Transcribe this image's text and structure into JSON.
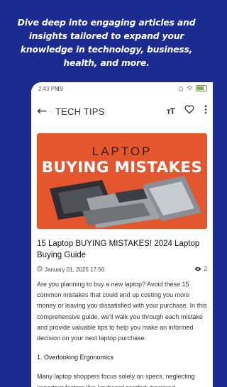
{
  "promo": {
    "line1": "Dive deep into engaging articles and",
    "line2": "insights tailored to expand your",
    "line3": "knowledge in technology, business,",
    "line4": "health, and more."
  },
  "statusbar": {
    "time": "2:43 PM",
    "indicator": "19"
  },
  "appbar": {
    "title": "TECH TIPS"
  },
  "hero": {
    "top": "LAPTOP",
    "main": "BUYING MISTAKES"
  },
  "article": {
    "title": "15 Laptop BUYING MISTAKES! 2024 Laptop Buying Guide",
    "date": "January 01, 2025 17:56",
    "views": "2",
    "intro": "Are you planning to buy a new laptop? Avoid these 15 common mistakes that could end up costing you more money or leaving you dissatisfied with your purchase. In this comprehensive guide, we'll walk you through each mistake and provide valuable tips to help you make an informed decision on your next laptop purchase.",
    "section1": "1. Overlooking Ergonomics",
    "para2": "Many laptop shoppers focus solely on specs, neglecting important factors like keyboard comfort, trackpad"
  },
  "colors": {
    "background": "#1c2b8f",
    "hero": "#e4572e"
  }
}
